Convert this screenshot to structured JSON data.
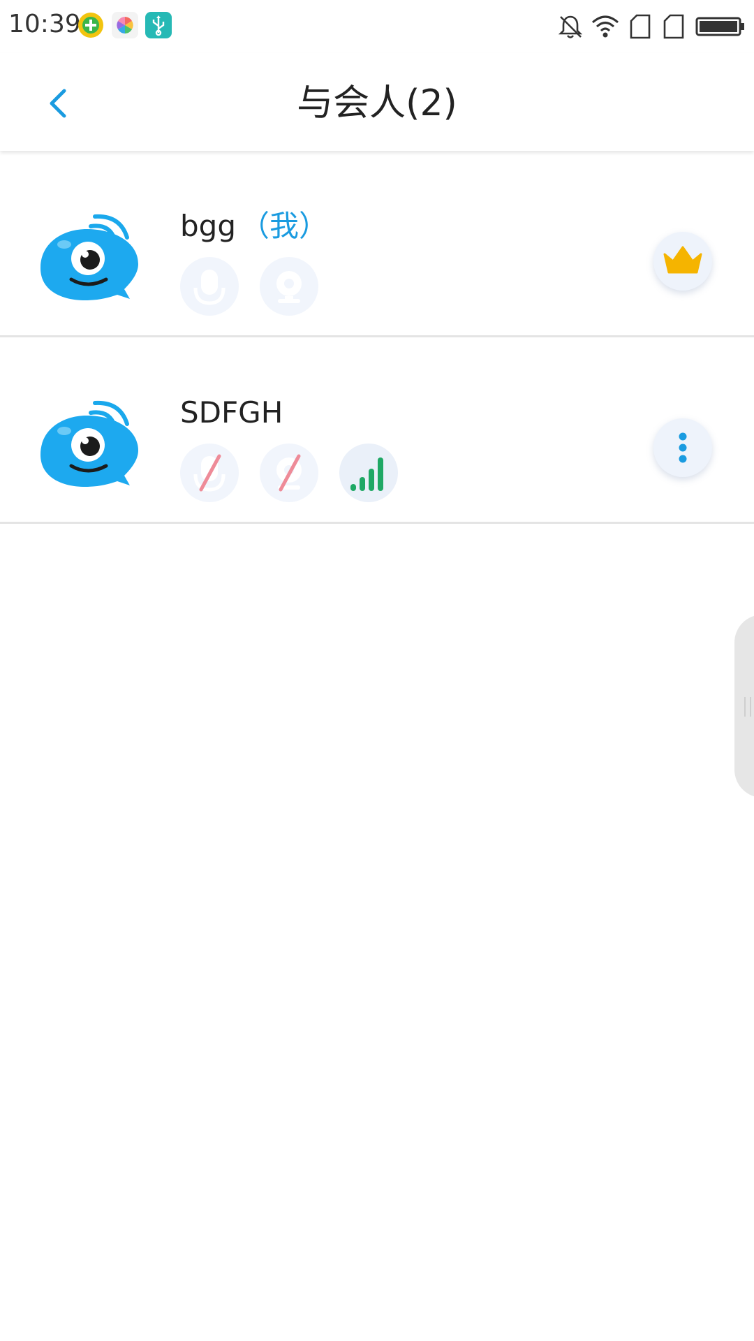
{
  "status_bar": {
    "time": "10:39",
    "left_icons": [
      "add-app-icon",
      "pinwheel-app-icon",
      "usb-icon"
    ],
    "right_icons": [
      "bell-muted-icon",
      "wifi-icon",
      "sim-card-1-icon",
      "sim-card-2-icon",
      "battery-icon"
    ]
  },
  "header": {
    "back_icon": "chevron-left-icon",
    "title": "与会人(2)"
  },
  "colors": {
    "accent": "#1a9be0",
    "crown": "#f5b400",
    "signal": "#1fa865",
    "muted_slash": "#ee8b98",
    "icon_bg": "#f1f5fc"
  },
  "participants": [
    {
      "name": "bgg",
      "tag": "（我）",
      "status_icons": [
        "microphone-icon",
        "camera-icon"
      ],
      "action_icon": "crown-icon"
    },
    {
      "name": "SDFGH",
      "tag": "",
      "status_icons": [
        "microphone-muted-icon",
        "camera-muted-icon",
        "signal-strength-icon"
      ],
      "action_icon": "more-vertical-icon"
    }
  ]
}
